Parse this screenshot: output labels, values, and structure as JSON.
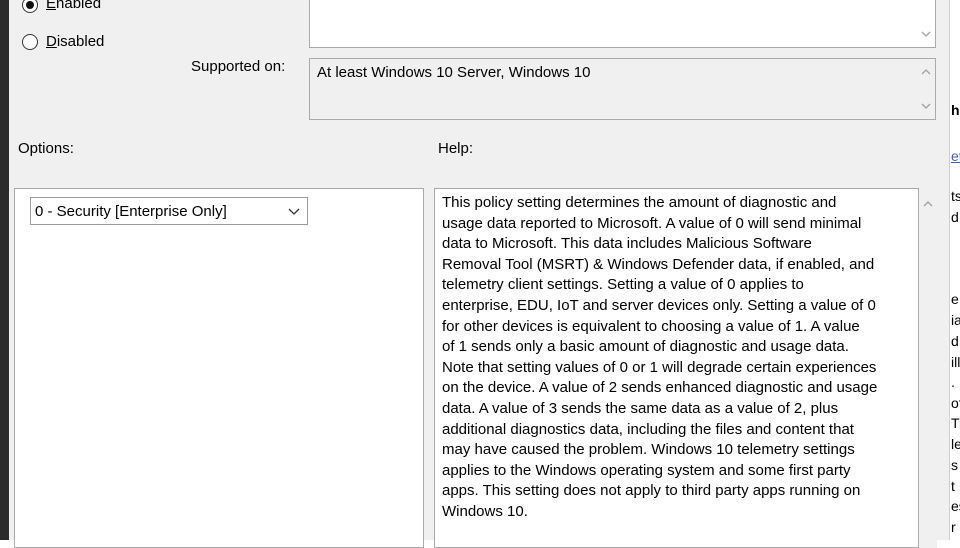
{
  "state": {
    "enabled_label": "nabled",
    "enabled_accel": "E",
    "disabled_label": "isabled",
    "disabled_accel": "D",
    "selected": "enabled"
  },
  "supported_on": {
    "label": "Supported on:",
    "value": "At least Windows 10 Server, Windows 10"
  },
  "options": {
    "label": "Options:",
    "dropdown_value": "0 - Security [Enterprise Only]"
  },
  "help": {
    "label": "Help:",
    "text": "This policy setting determines the amount of diagnostic and\nusage data reported to Microsoft. A value of 0 will send minimal\ndata to Microsoft. This data includes Malicious Software\nRemoval Tool (MSRT) & Windows Defender data, if enabled, and\ntelemetry client settings. Setting a value of 0 applies to\nenterprise, EDU, IoT and server devices only. Setting a value of 0\nfor other devices is equivalent to choosing a value of 1. A value\nof 1 sends only a basic amount of diagnostic and usage data.\nNote that setting values of 0 or 1 will degrade certain experiences\non the device. A value of 2 sends enhanced diagnostic and usage\ndata. A value of 3 sends the same data as a value of 2, plus\nadditional diagnostics data, including the files and content that\nmay have caused the problem. Windows 10 telemetry settings\napplies to the Windows operating system and some first party\napps. This setting does not apply to third party apps running on\nWindows 10."
  },
  "background_fragments": [
    "he",
    "et",
    "ts",
    "d",
    "e",
    "ia",
    "d",
    "ill",
    ".",
    "of",
    "Ti",
    "le",
    "s",
    "t",
    "es",
    "r"
  ]
}
